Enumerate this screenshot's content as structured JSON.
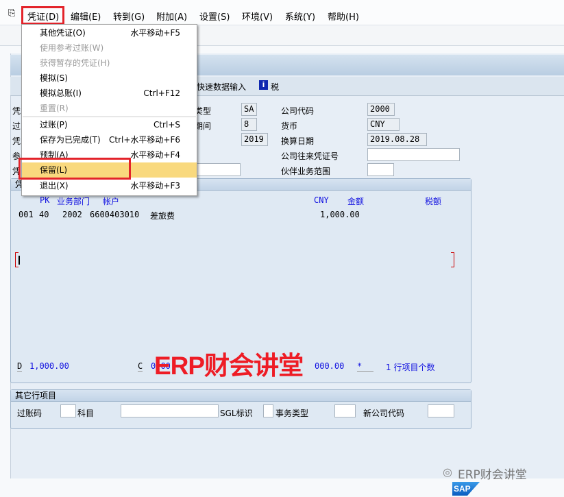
{
  "menubar": {
    "items": [
      "凭证(D)",
      "编辑(E)",
      "转到(G)",
      "附加(A)",
      "设置(S)",
      "环境(V)",
      "系统(Y)",
      "帮助(H)"
    ]
  },
  "toolbar": {
    "icons": [
      "enter-icon",
      "home-icon",
      "cancel-icon",
      "print-icon",
      "find-icon",
      "find-next-icon",
      "first-page-icon",
      "prev-page-icon",
      "next-page-icon",
      "last-page-icon",
      "new-session-icon",
      "shortcut-icon",
      "help-icon",
      "layout-icon"
    ]
  },
  "apptoolbar": {
    "fast_entry": "快速数据输入",
    "tax": "税"
  },
  "form": {
    "left_labels": [
      "凭",
      "过",
      "凭",
      "参",
      "凭"
    ],
    "doc_type_label": "类型",
    "doc_type": "SA",
    "period_label": "期间",
    "period": "8",
    "fiscal_year": "2019",
    "company_code_label": "公司代码",
    "company_code": "2000",
    "currency_label": "货币",
    "currency": "CNY",
    "translation_date_label": "换算日期",
    "translation_date": "2019.08.28",
    "intercompany_label": "公司往来凭证号",
    "intercompany": "",
    "partner_ba_label": "伙伴业务范围",
    "partner_ba": ""
  },
  "items_group": {
    "title": "凭",
    "headers": {
      "pk": "PK",
      "business_area": "业务部门",
      "account": "帐户",
      "currency": "CNY",
      "amount": "金额",
      "tax": "税额"
    },
    "rows": [
      {
        "no": "001",
        "pk": "40",
        "ba": "2002",
        "account": "6600403010",
        "text": "差旅费",
        "amount": "1,000.00"
      }
    ],
    "totals": {
      "d_label": "D",
      "debit": "1,000.00",
      "c_label": "C",
      "credit": "0.00",
      "balance": "000.00",
      "star": "*",
      "count": "1 行项目个数"
    }
  },
  "other_group": {
    "title": "其它行项目",
    "posting_key": "过账码",
    "account": "科目",
    "sgl": "SGL标识",
    "trans_type": "事务类型",
    "new_company": "新公司代码"
  },
  "menu": {
    "items": [
      {
        "label": "其他凭证(O)",
        "shortcut": "水平移动+F5",
        "disabled": false
      },
      {
        "label": "使用参考过账(W)",
        "shortcut": "",
        "disabled": true
      },
      {
        "label": "获得暂存的凭证(H)",
        "shortcut": "",
        "disabled": true
      },
      {
        "label": "模拟(S)",
        "shortcut": "",
        "disabled": false
      },
      {
        "label": "模拟总账(I)",
        "shortcut": "Ctrl+F12",
        "disabled": false
      },
      {
        "label": "重置(R)",
        "shortcut": "",
        "disabled": true
      },
      {
        "label": "过账(P)",
        "shortcut": "Ctrl+S",
        "disabled": false
      },
      {
        "label": "保存为已完成(T)",
        "shortcut": "Ctrl+水平移动+F6",
        "disabled": false
      },
      {
        "label": "预制(A)",
        "shortcut": "水平移动+F4",
        "disabled": false
      },
      {
        "label": "保留(L)",
        "shortcut": "",
        "disabled": false,
        "highlighted": true
      },
      {
        "label": "退出(X)",
        "shortcut": "水平移动+F3",
        "disabled": false
      }
    ]
  },
  "watermark": {
    "main": "ERP财会讲堂",
    "footer": "ERP财会讲堂",
    "logo": "SAP"
  },
  "colors": {
    "highlight": "#f9d97e",
    "annotation_red": "#e3232a",
    "field_blue": "#1010e0"
  }
}
